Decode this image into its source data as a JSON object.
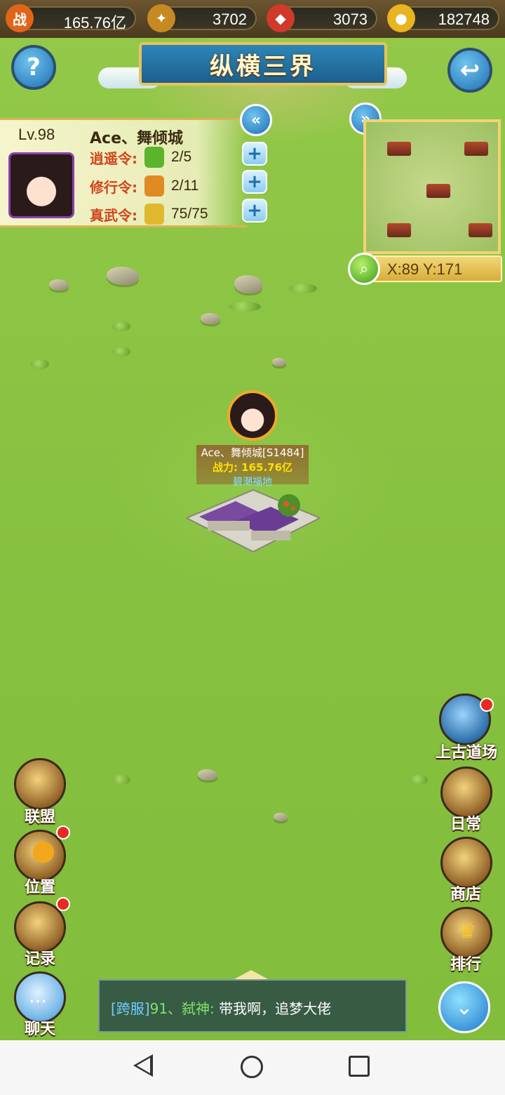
{
  "resources": [
    {
      "icon": "battle-power-icon",
      "icon_text": "战",
      "value": "165.76亿",
      "color": "#e0651a"
    },
    {
      "icon": "jade-token-icon",
      "value": "3702",
      "color": "#c78a23"
    },
    {
      "icon": "red-gem-icon",
      "value": "3073",
      "color": "#cf3a2a"
    },
    {
      "icon": "gold-ingot-icon",
      "value": "182748",
      "color": "#e8b420"
    }
  ],
  "title": "纵横三界",
  "player": {
    "level": "Lv.98",
    "name": "Ace、舞倾城",
    "tokens": [
      {
        "label": "逍遥令:",
        "value": "2/5",
        "icon": "xiaoyao-token-icon",
        "color": "#5cb42a"
      },
      {
        "label": "修行令:",
        "value": "2/11",
        "icon": "xiuxing-token-icon",
        "color": "#e08a22"
      },
      {
        "label": "真武令:",
        "value": "75/75",
        "icon": "zhenwu-token-icon",
        "color": "#e0b830"
      }
    ]
  },
  "minimap": {
    "coords": "X:89  Y:171"
  },
  "city": {
    "name": "Ace、舞倾城[S1484]",
    "power": "战力: 165.76亿",
    "location": "碧潮福地"
  },
  "left_menu": [
    {
      "label": "联盟",
      "badge": false
    },
    {
      "label": "位置",
      "badge": true
    },
    {
      "label": "记录",
      "badge": true
    },
    {
      "label": "聊天",
      "badge": false
    }
  ],
  "right_menu": [
    {
      "label": "上古道场",
      "badge": true
    },
    {
      "label": "日常",
      "badge": false
    },
    {
      "label": "商店",
      "badge": false
    },
    {
      "label": "排行",
      "badge": false
    }
  ],
  "chat": {
    "channel": "[跨服]",
    "sender": "91、弑神:",
    "message": " 带我啊，追梦大佬"
  },
  "colors": {
    "grass": "#86c03f",
    "banner_blue": "#1d5f8e",
    "gold_border": "#e8c35a",
    "chat_channel": "#6fd0ff",
    "chat_sender": "#7fe36a"
  }
}
